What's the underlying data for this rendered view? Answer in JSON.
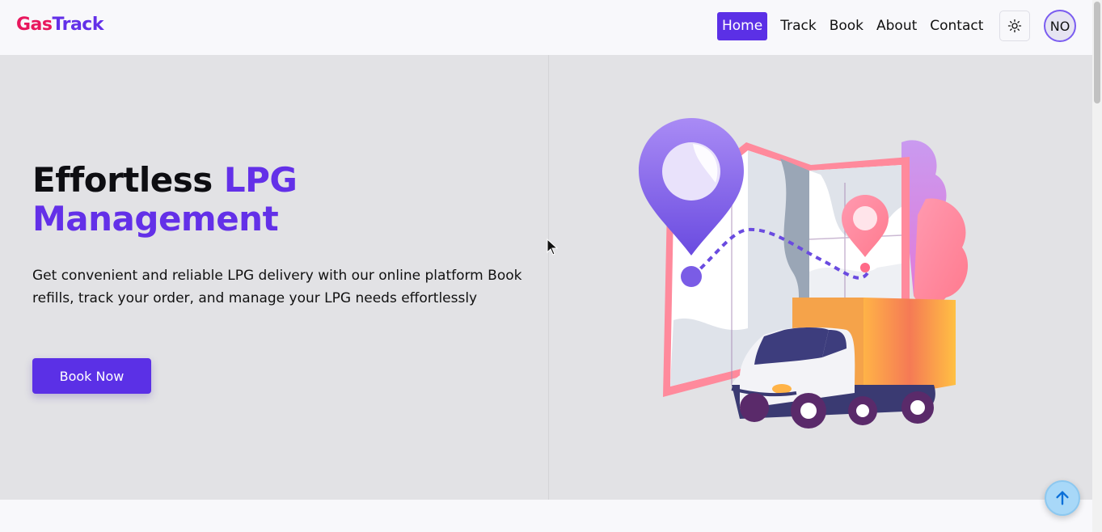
{
  "brand": {
    "part1": "Gas",
    "part2": "Track",
    "color1": "#e8175d",
    "color2": "#6330e8"
  },
  "nav": {
    "items": [
      {
        "label": "Home",
        "active": true
      },
      {
        "label": "Track",
        "active": false
      },
      {
        "label": "Book",
        "active": false
      },
      {
        "label": "About",
        "active": false
      },
      {
        "label": "Contact",
        "active": false
      }
    ],
    "theme_icon": "sun-icon",
    "avatar_initials": "NO"
  },
  "hero": {
    "title_plain": "Effortless ",
    "title_accent_1": "LPG",
    "title_accent_2": "Management",
    "description": "Get convenient and reliable LPG delivery with our online platform Book refills, track your order, and manage your LPG needs effortlessly",
    "cta_label": "Book Now",
    "illustration": "delivery-truck-map-illustration"
  },
  "colors": {
    "primary": "#5b30e6",
    "hero_bg": "#e2e2e5",
    "page_bg": "#f8f8fb"
  },
  "scroll_top_icon": "arrow-up-icon"
}
